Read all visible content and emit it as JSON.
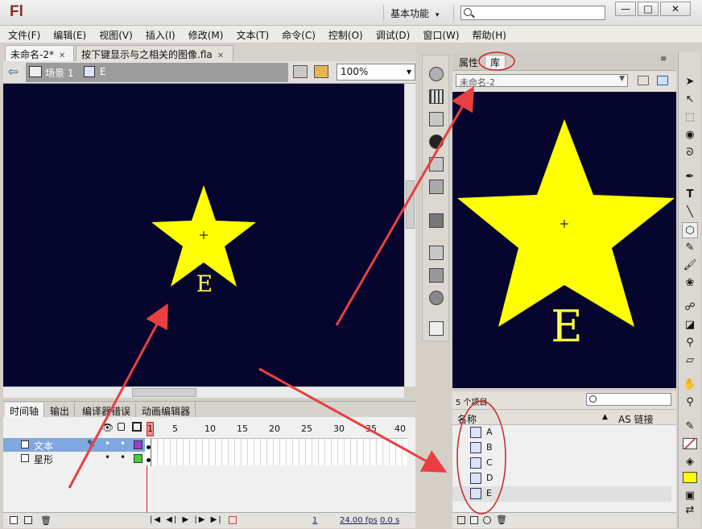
{
  "app": {
    "logo": "Fl",
    "workspace": "基本功能",
    "workspace_arrow": "▾"
  },
  "window_controls": {
    "minimize": "—",
    "restore": "□",
    "close": "✕"
  },
  "menu": [
    "文件(F)",
    "编辑(E)",
    "视图(V)",
    "插入(I)",
    "修改(M)",
    "文本(T)",
    "命令(C)",
    "控制(O)",
    "调试(D)",
    "窗口(W)",
    "帮助(H)"
  ],
  "doc_tabs": [
    {
      "label": "未命名-2*",
      "close": "✕"
    },
    {
      "label": "按下键显示与之相关的图像.fla",
      "close": "✕"
    }
  ],
  "edit_bar": {
    "back_arrow": "⇦",
    "scene": "场景 1",
    "symbol": "E",
    "zoom": "100%",
    "zoom_arrow": "▾"
  },
  "stage": {
    "letter": "E",
    "background": "#05052e",
    "star_color": "#ffff00"
  },
  "timeline": {
    "tabs": [
      "时间轴",
      "输出",
      "编译器错误",
      "动画编辑器"
    ],
    "frame_ticks": [
      "1",
      "5",
      "10",
      "15",
      "20",
      "25",
      "30",
      "35",
      "40"
    ],
    "layers": [
      {
        "name": "文本",
        "color": "#9b3fd0",
        "selected": true
      },
      {
        "name": "星形",
        "color": "#3fd03f",
        "selected": false
      }
    ],
    "footer": {
      "current_frame": "1",
      "fps": "24.00 fps",
      "time": "0.0 s"
    }
  },
  "panel": {
    "tabs": [
      "属性",
      "库"
    ],
    "library_doc": "未命名-2",
    "preview_letter": "E",
    "item_count": "5 个项目",
    "col_name": "名称",
    "col_link": "AS 链接",
    "items": [
      "A",
      "B",
      "C",
      "D",
      "E"
    ]
  },
  "colors": {
    "annotation": "#e84040",
    "highlight_stroke": "#cc2222",
    "fill_swatch": "#ffff00"
  },
  "tools": [
    "selection-tool",
    "subselection-tool",
    "free-transform-tool",
    "3d-rotation-tool",
    "lasso-tool",
    "pen-tool",
    "text-tool",
    "line-tool",
    "rectangle-tool",
    "pencil-tool",
    "brush-tool",
    "deco-tool",
    "bone-tool",
    "paint-bucket-tool",
    "eyedropper-tool",
    "eraser-tool",
    "hand-tool",
    "zoom-tool"
  ]
}
